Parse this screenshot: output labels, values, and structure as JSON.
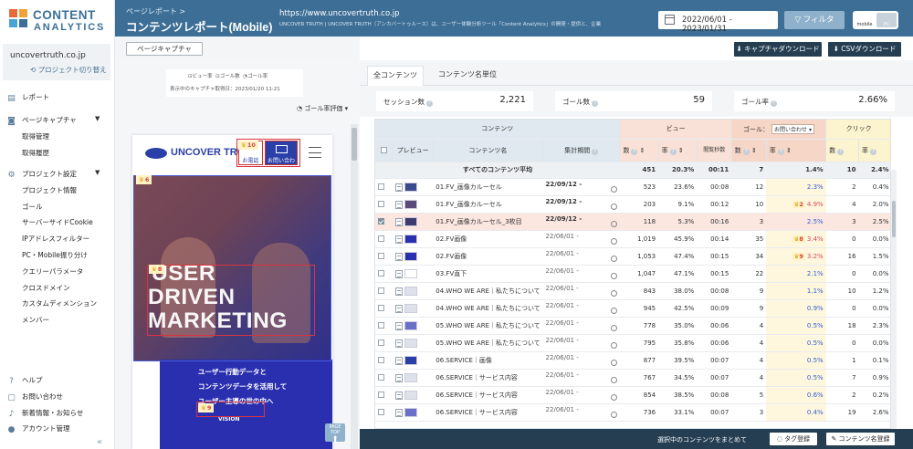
{
  "brand": {
    "line1": "CONTENT",
    "line2": "ANALYTICS"
  },
  "sidebar": {
    "site_name": "uncovertruth.co.jp",
    "switch_project": "⟲ プロジェクト切り替え",
    "items": [
      {
        "label": "レポート"
      },
      {
        "label": "ページキャプチャ"
      },
      {
        "label": "取得管理"
      },
      {
        "label": "取得履歴"
      },
      {
        "label": "プロジェクト設定"
      },
      {
        "label": "プロジェクト情報"
      },
      {
        "label": "ゴール"
      },
      {
        "label": "サーバーサイドCookie"
      },
      {
        "label": "IPアドレスフィルター"
      },
      {
        "label": "PC・Mobile振り分け"
      },
      {
        "label": "クエリーパラメータ"
      },
      {
        "label": "クロスドメイン"
      },
      {
        "label": "カスタムディメンション"
      },
      {
        "label": "メンバー"
      }
    ],
    "bottom": [
      {
        "label": "ヘルプ"
      },
      {
        "label": "お問い合わせ"
      },
      {
        "label": "新着情報・お知らせ"
      },
      {
        "label": "アカウント管理"
      }
    ]
  },
  "header": {
    "breadcrumb": "ページレポート >",
    "title": "コンテンツレポート(Mobile)",
    "url": "https://www.uncovertruth.co.jp",
    "description": "UNCOVER TRUTH | UNCOVER TRUTH（アンカバートゥルース）は、ユーザー体験分析ツール「Content Analytics」の開発・提供と、企業",
    "date_range": "2022/06/01 - 2023/01/31",
    "filter_label": "フィルタ",
    "device_mobile": "mobile",
    "device_pc": "PC"
  },
  "capture": {
    "button": "ページキャプチャ",
    "legend": [
      "ビュー率",
      "ゴール数",
      "ゴール率"
    ],
    "capture_date": "表示中のキャプチャ取得日：2023/01/20 11:21",
    "goal_eval": "ゴール率評価"
  },
  "mobile_page": {
    "logo": "UNCOVER TRUTH",
    "phone_label": "お電話",
    "mail_label": "お問い合わせ",
    "hero_lines": [
      "USER",
      "DRIVEN",
      "MARKETING"
    ],
    "blue_lines": [
      "ユーザー行動データと",
      "コンテンツデータを活用して",
      "ユーザー主導の世の中へ"
    ],
    "vision": "VISION",
    "pagetop": "PAGE TOP",
    "badges": [
      {
        "num": "6"
      },
      {
        "num": "10"
      },
      {
        "num": "8"
      },
      {
        "num": "9"
      }
    ]
  },
  "toolbar": {
    "capture_download": "キャプチャダウンロード",
    "csv_download": "CSVダウンロード"
  },
  "tabs": [
    {
      "label": "全コンテンツ"
    },
    {
      "label": "コンテンツ名単位"
    }
  ],
  "stats": [
    {
      "label": "セッション数",
      "value": "2,221"
    },
    {
      "label": "ゴール数",
      "value": "59"
    },
    {
      "label": "ゴール率",
      "value": "2.66%"
    }
  ],
  "table": {
    "groups": {
      "content": "コンテンツ",
      "view": "ビュー",
      "goal": "ゴール：",
      "goal_select": "お問い合わせ ▾",
      "click": "クリック"
    },
    "cols": {
      "preview": "プレビュー",
      "name": "コンテンツ名",
      "period": "集計期間",
      "view_count": "数",
      "view_rate": "率",
      "dwell": "閲覧秒数",
      "goal_count": "数",
      "goal_rate": "率",
      "click_count": "数",
      "click_rate": "率"
    },
    "avg": {
      "label": "すべてのコンテンツ平均",
      "view_count": "451",
      "view_rate": "20.3%",
      "dwell": "00:11",
      "goal_count": "7",
      "goal_rate": "1.4%",
      "click_count": "10",
      "click_rate": "2.4%"
    },
    "rows": [
      {
        "name": "01.FV_画像カルーセル",
        "period": "22/09/12 -",
        "bold_period": true,
        "views": "523",
        "view_rate": "23.6%",
        "dwell": "00:08",
        "goals": "12",
        "goal_badge": "",
        "goal_rate": "2.3%",
        "rate_color": "blue",
        "clicks": "2",
        "click_rate": "0.4%",
        "checked": false,
        "selected": false,
        "thumb": "#3a4a8c"
      },
      {
        "name": "01.FV_画像カルーセル",
        "period": "22/09/12 -",
        "bold_period": true,
        "views": "203",
        "view_rate": "9.1%",
        "dwell": "00:12",
        "goals": "10",
        "goal_badge": "2",
        "goal_rate": "4.9%",
        "rate_color": "red",
        "clicks": "4",
        "click_rate": "2.0%",
        "checked": false,
        "selected": false,
        "thumb": "#5a4a7c"
      },
      {
        "name": "01.FV_画像カルーセル_3枚目",
        "period": "22/09/12 -",
        "bold_period": true,
        "views": "118",
        "view_rate": "5.3%",
        "dwell": "00:16",
        "goals": "3",
        "goal_badge": "",
        "goal_rate": "2.5%",
        "rate_color": "blue",
        "clicks": "3",
        "click_rate": "2.5%",
        "checked": true,
        "selected": true,
        "thumb": "#3e3a6e"
      },
      {
        "name": "02.FV画像",
        "period": "22/06/01 -",
        "bold_period": false,
        "views": "1,019",
        "view_rate": "45.9%",
        "dwell": "00:14",
        "goals": "35",
        "goal_badge": "8",
        "goal_rate": "3.4%",
        "rate_color": "red",
        "clicks": "0",
        "click_rate": "0.0%",
        "checked": false,
        "selected": false,
        "thumb": "#2a2fb0"
      },
      {
        "name": "02.FV画像",
        "period": "22/06/01 -",
        "bold_period": false,
        "views": "1,053",
        "view_rate": "47.4%",
        "dwell": "00:15",
        "goals": "34",
        "goal_badge": "9",
        "goal_rate": "3.2%",
        "rate_color": "red",
        "clicks": "16",
        "click_rate": "1.5%",
        "checked": false,
        "selected": false,
        "thumb": "#2a2fb0"
      },
      {
        "name": "03.FV直下",
        "period": "22/06/01 -",
        "bold_period": false,
        "views": "1,047",
        "view_rate": "47.1%",
        "dwell": "00:15",
        "goals": "22",
        "goal_badge": "",
        "goal_rate": "2.1%",
        "rate_color": "blue",
        "clicks": "0",
        "click_rate": "0.0%",
        "checked": false,
        "selected": false,
        "thumb": "#ffffff"
      },
      {
        "name": "04.WHO WE ARE｜私たちについて",
        "period": "22/06/01 -",
        "bold_period": false,
        "views": "843",
        "view_rate": "38.0%",
        "dwell": "00:08",
        "goals": "9",
        "goal_badge": "",
        "goal_rate": "1.1%",
        "rate_color": "blue",
        "clicks": "10",
        "click_rate": "1.2%",
        "checked": false,
        "selected": false,
        "thumb": "#dde1ea"
      },
      {
        "name": "04.WHO WE ARE｜私たちについて",
        "period": "22/06/01 -",
        "bold_period": false,
        "views": "945",
        "view_rate": "42.5%",
        "dwell": "00:09",
        "goals": "9",
        "goal_badge": "",
        "goal_rate": "0.9%",
        "rate_color": "blue",
        "clicks": "0",
        "click_rate": "0.0%",
        "checked": false,
        "selected": false,
        "thumb": "#dde1ea"
      },
      {
        "name": "05.WHO WE ARE｜私たちについて",
        "period": "22/06/01 -",
        "bold_period": false,
        "views": "778",
        "view_rate": "35.0%",
        "dwell": "00:06",
        "goals": "4",
        "goal_badge": "",
        "goal_rate": "0.5%",
        "rate_color": "blue",
        "clicks": "18",
        "click_rate": "2.3%",
        "checked": false,
        "selected": false,
        "thumb": "#6a6fc8"
      },
      {
        "name": "05.WHO WE ARE｜私たちについて",
        "period": "22/06/01 -",
        "bold_period": false,
        "views": "795",
        "view_rate": "35.8%",
        "dwell": "00:06",
        "goals": "4",
        "goal_badge": "",
        "goal_rate": "0.5%",
        "rate_color": "blue",
        "clicks": "0",
        "click_rate": "0.0%",
        "checked": false,
        "selected": false,
        "thumb": "#dde1ea"
      },
      {
        "name": "06.SERVICE｜画像",
        "period": "22/06/01 -",
        "bold_period": false,
        "views": "877",
        "view_rate": "39.5%",
        "dwell": "00:07",
        "goals": "4",
        "goal_badge": "",
        "goal_rate": "0.5%",
        "rate_color": "blue",
        "clicks": "1",
        "click_rate": "0.1%",
        "checked": false,
        "selected": false,
        "thumb": "#2a3fa8"
      },
      {
        "name": "06.SERVICE｜サービス内容",
        "period": "22/06/01 -",
        "bold_period": false,
        "views": "767",
        "view_rate": "34.5%",
        "dwell": "00:07",
        "goals": "4",
        "goal_badge": "",
        "goal_rate": "0.5%",
        "rate_color": "blue",
        "clicks": "7",
        "click_rate": "0.9%",
        "checked": false,
        "selected": false,
        "thumb": "#dde1ea"
      },
      {
        "name": "06.SERVICE｜サービス内容",
        "period": "22/06/01 -",
        "bold_period": false,
        "views": "854",
        "view_rate": "38.5%",
        "dwell": "00:08",
        "goals": "5",
        "goal_badge": "",
        "goal_rate": "0.6%",
        "rate_color": "blue",
        "clicks": "2",
        "click_rate": "0.2%",
        "checked": false,
        "selected": false,
        "thumb": "#dde1ea"
      },
      {
        "name": "06.SERVICE｜サービス内容",
        "period": "22/06/01 -",
        "bold_period": false,
        "views": "736",
        "view_rate": "33.1%",
        "dwell": "00:07",
        "goals": "3",
        "goal_badge": "",
        "goal_rate": "0.4%",
        "rate_color": "blue",
        "clicks": "19",
        "click_rate": "2.6%",
        "checked": false,
        "selected": false,
        "thumb": "#6a6fc8"
      }
    ]
  },
  "bottom_bar": {
    "label": "選択中のコンテンツをまとめて",
    "tag_button": "タグ登録",
    "name_button": "コンテンツ名登録"
  },
  "colors": {
    "header": "#3c6e96",
    "dark": "#253e52",
    "accent_red": "#d24b5e",
    "accent_blue": "#2f5fd0"
  }
}
